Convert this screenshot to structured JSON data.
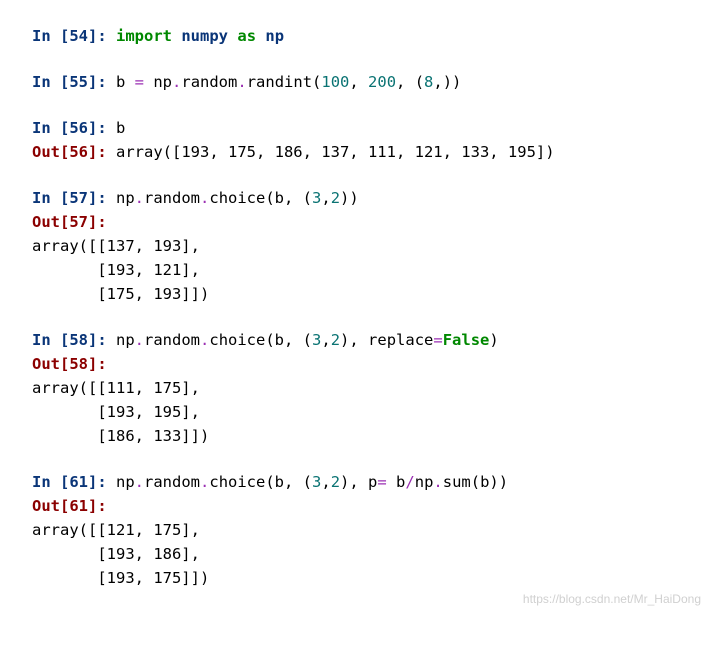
{
  "cells": [
    {
      "in_num": "54",
      "code_html": "<span class='kw-green'>import</span> <span class='kw-navy'>numpy</span> <span class='kw-green'>as</span> <span class='kw-navy'>np</span>"
    },
    {
      "in_num": "55",
      "code_html": "b <span class='op-purple'>=</span> np<span class='op-purple'>.</span>random<span class='op-purple'>.</span>randint(<span class='num-teal'>100</span>, <span class='num-teal'>200</span>, (<span class='num-teal'>8</span>,))"
    },
    {
      "in_num": "56",
      "code_html": "b",
      "out_num": "56",
      "out_inline": "array([193, 175, 186, 137, 111, 121, 133, 195])"
    },
    {
      "in_num": "57",
      "code_html": "np<span class='op-purple'>.</span>random<span class='op-purple'>.</span>choice(b, (<span class='num-teal'>3</span>,<span class='num-teal'>2</span>))",
      "out_num": "57",
      "out_lines": [
        "array([[137, 193],",
        "       [193, 121],",
        "       [175, 193]])"
      ]
    },
    {
      "in_num": "58",
      "code_html": "np<span class='op-purple'>.</span>random<span class='op-purple'>.</span>choice(b, (<span class='num-teal'>3</span>,<span class='num-teal'>2</span>), replace<span class='op-purple'>=</span><span class='kw-green'>False</span>)",
      "out_num": "58",
      "out_lines": [
        "array([[111, 175],",
        "       [193, 195],",
        "       [186, 133]])"
      ]
    },
    {
      "in_num": "61",
      "code_html": "np<span class='op-purple'>.</span>random<span class='op-purple'>.</span>choice(b, (<span class='num-teal'>3</span>,<span class='num-teal'>2</span>), p<span class='op-purple'>=</span> b<span class='op-purple'>/</span>np<span class='op-purple'>.</span>sum(b))",
      "out_num": "61",
      "out_lines": [
        "array([[121, 175],",
        "       [193, 186],",
        "       [193, 175]])"
      ]
    }
  ],
  "watermark": "https://blog.csdn.net/Mr_HaiDong"
}
